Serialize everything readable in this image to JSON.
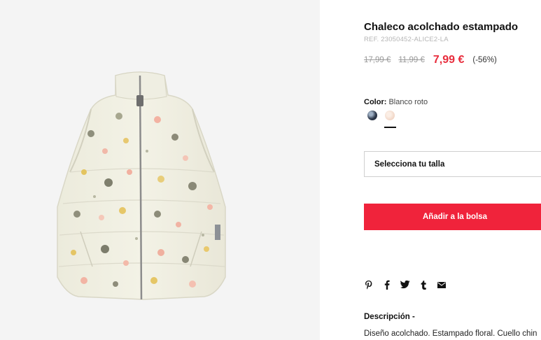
{
  "product": {
    "title": "Chaleco acolchado estampado",
    "ref": "REF. 23050452-ALICE2-LA",
    "prices": {
      "original": "17,99 €",
      "previous": "11,99 €",
      "current": "7,99 €",
      "discount": "(-56%)"
    },
    "color": {
      "label": "Color:",
      "value": "Blanco roto",
      "swatches": [
        {
          "name": "dark-floral",
          "color": "#2f3a4c"
        },
        {
          "name": "blanco-roto",
          "color": "#f3dccd"
        }
      ]
    },
    "size_select": {
      "placeholder": "Selecciona tu talla"
    },
    "add_to_bag": "Añadir a la bolsa",
    "share_icons": [
      "pinterest-icon",
      "facebook-icon",
      "twitter-icon",
      "tumblr-icon",
      "email-icon"
    ],
    "description": {
      "title": "Descripción -",
      "text": "Diseño acolchado. Estampado floral. Cuello chin"
    }
  },
  "colors": {
    "accent": "#f0233b",
    "price_red": "#e82c3c",
    "gallery_bg": "#f4f4f4"
  }
}
